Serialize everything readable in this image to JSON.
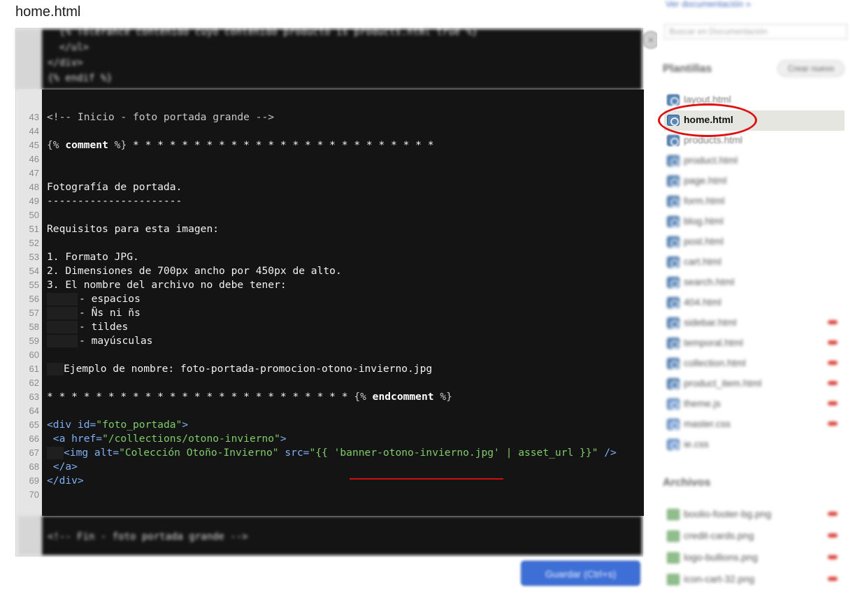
{
  "window": {
    "file_title": "home.html"
  },
  "editor": {
    "top_blurred_lines": [
      "  {% Tolerance contenido cuyo contenido producto is products.html true %}",
      "  </ul>",
      "</div>",
      "{% endif %}"
    ],
    "lines": [
      {
        "num": "43",
        "parts": [
          {
            "t": "<!-- Inicio - foto portada grande -->",
            "c": "c-liq"
          }
        ]
      },
      {
        "num": "44",
        "parts": []
      },
      {
        "num": "45",
        "parts": [
          {
            "t": "{%",
            "c": "c-liq"
          },
          {
            "t": " comment ",
            "c": "c-bold"
          },
          {
            "t": "%}",
            "c": "c-liq"
          },
          {
            "t": " * * * * * * * * * * * * * * * * * * * * * * * * *",
            "c": "c-white"
          }
        ]
      },
      {
        "num": "46",
        "parts": []
      },
      {
        "num": "47",
        "parts": []
      },
      {
        "num": "48",
        "parts": [
          {
            "t": "Fotografía de portada.",
            "c": "c-white"
          }
        ]
      },
      {
        "num": "49",
        "parts": [
          {
            "t": "----------------------",
            "c": "c-white"
          }
        ]
      },
      {
        "num": "50",
        "parts": []
      },
      {
        "num": "51",
        "parts": [
          {
            "t": "Requisitos para esta imagen:",
            "c": "c-white"
          }
        ]
      },
      {
        "num": "52",
        "parts": []
      },
      {
        "num": "53",
        "parts": [
          {
            "t": "1. Formato JPG.",
            "c": "c-white"
          }
        ]
      },
      {
        "num": "54",
        "parts": [
          {
            "t": "2. Dimensiones de 700px ancho por 450px de alto.",
            "c": "c-white"
          }
        ]
      },
      {
        "num": "55",
        "parts": [
          {
            "t": "3. El nombre del archivo no debe tener:",
            "c": "c-white"
          }
        ]
      },
      {
        "num": "56",
        "indent": "big",
        "parts": [
          {
            "t": "- espacios",
            "c": "c-white"
          }
        ]
      },
      {
        "num": "57",
        "indent": "big",
        "parts": [
          {
            "t": "- Ñs ni ñs",
            "c": "c-white"
          }
        ]
      },
      {
        "num": "58",
        "indent": "big",
        "parts": [
          {
            "t": "- tildes",
            "c": "c-white"
          }
        ]
      },
      {
        "num": "59",
        "indent": "big",
        "parts": [
          {
            "t": "- mayúsculas",
            "c": "c-white"
          }
        ]
      },
      {
        "num": "60",
        "parts": []
      },
      {
        "num": "61",
        "indent": "small",
        "parts": [
          {
            "t": "Ejemplo de nombre: foto-portada-promocion-otono-invierno.jpg",
            "c": "c-white"
          }
        ]
      },
      {
        "num": "62",
        "parts": []
      },
      {
        "num": "63",
        "parts": [
          {
            "t": "* * * * * * * * * * * * * * * * * * * * * * * * * ",
            "c": "c-white"
          },
          {
            "t": "{%",
            "c": "c-liq"
          },
          {
            "t": " endcomment ",
            "c": "c-bold"
          },
          {
            "t": "%}",
            "c": "c-liq"
          }
        ]
      },
      {
        "num": "64",
        "parts": []
      },
      {
        "num": "65",
        "parts": [
          {
            "t": "<div id=",
            "c": "c-tag"
          },
          {
            "t": "\"foto_portada\"",
            "c": "c-str"
          },
          {
            "t": ">",
            "c": "c-tag"
          }
        ]
      },
      {
        "num": "66",
        "parts": [
          {
            "t": " <a href=",
            "c": "c-tag"
          },
          {
            "t": "\"/collections/otono-invierno\"",
            "c": "c-str"
          },
          {
            "t": ">",
            "c": "c-tag"
          }
        ]
      },
      {
        "num": "67",
        "indent": "small",
        "parts": [
          {
            "t": "<img alt=",
            "c": "c-tag"
          },
          {
            "t": "\"Colección Otoño-Invierno\"",
            "c": "c-str"
          },
          {
            "t": " src=",
            "c": "c-tag"
          },
          {
            "t": "\"{{ 'banner-otono-invierno.jpg' | asset_url }}\"",
            "c": "c-str"
          },
          {
            "t": " />",
            "c": "c-tag"
          }
        ]
      },
      {
        "num": "68",
        "parts": [
          {
            "t": " </a>",
            "c": "c-tag"
          }
        ]
      },
      {
        "num": "69",
        "parts": [
          {
            "t": "</div>",
            "c": "c-tag"
          }
        ]
      },
      {
        "num": "70",
        "parts": []
      }
    ],
    "bottom_blurred_lines": [
      "<!-- Fin - foto portada grande -->"
    ],
    "save_label": "Guardar (Ctrl+s)"
  },
  "sidebar": {
    "doc_link": "Ver documentación »",
    "search_placeholder": "Buscar en Documentación",
    "templates_title": "Plantillas",
    "create_new": "Crear nuevo",
    "templates": [
      {
        "name": "layout.html",
        "state": "faded"
      },
      {
        "name": "home.html",
        "state": "selected"
      },
      {
        "name": "products.html",
        "state": "faded"
      },
      {
        "name": "product.html",
        "state": "blur"
      },
      {
        "name": "page.html",
        "state": "blur"
      },
      {
        "name": "form.html",
        "state": "blur"
      },
      {
        "name": "blog.html",
        "state": "blur"
      },
      {
        "name": "post.html",
        "state": "blur"
      },
      {
        "name": "cart.html",
        "state": "blur"
      },
      {
        "name": "search.html",
        "state": "blur"
      },
      {
        "name": "404.html",
        "state": "blur"
      },
      {
        "name": "sidebar.html",
        "state": "blur",
        "deletable": true
      },
      {
        "name": "temporal.html",
        "state": "blur",
        "deletable": true
      },
      {
        "name": "collection.html",
        "state": "blur",
        "deletable": true
      },
      {
        "name": "product_item.html",
        "state": "blur",
        "deletable": true
      },
      {
        "name": "theme.js",
        "state": "blur",
        "deletable": true,
        "kind": "js"
      },
      {
        "name": "master.css",
        "state": "blur",
        "deletable": true,
        "kind": "css"
      },
      {
        "name": "ie.css",
        "state": "blur",
        "kind": "css"
      }
    ],
    "assets_title": "Archivos",
    "assets": [
      {
        "name": "boolio-footer-bg.png"
      },
      {
        "name": "credit-cards.png"
      },
      {
        "name": "logo-bullions.png"
      },
      {
        "name": "icon-cart-32.png"
      }
    ]
  }
}
